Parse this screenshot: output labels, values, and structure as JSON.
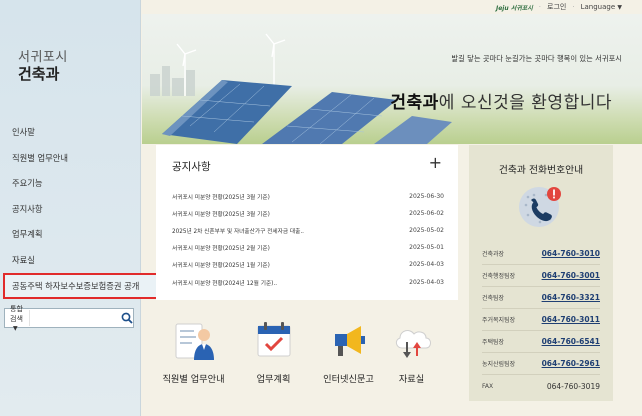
{
  "topbar": {
    "logo_text": "Jeju 서귀포시",
    "login": "로그인",
    "language": "Language"
  },
  "sidebar": {
    "site_name": "서귀포시",
    "title": "건축과",
    "menu": [
      {
        "label": "인사말"
      },
      {
        "label": "직원별 업무안내"
      },
      {
        "label": "주요기능"
      },
      {
        "label": "공지사항"
      },
      {
        "label": "업무계획"
      },
      {
        "label": "자료실"
      },
      {
        "label": "공동주택 하자보수보증보험증권 공개"
      }
    ],
    "search": {
      "select_label": "통합검색",
      "placeholder": ""
    }
  },
  "hero": {
    "slogan": "발길 닿는 곳마다 눈길가는 곳마다 행복이 있는 서귀포시",
    "welcome_bold": "건축과",
    "welcome_rest": "에 오신것을 환영합니다"
  },
  "notice": {
    "title": "공지사항",
    "more": "+",
    "items": [
      {
        "title": "서귀포시 미분양 현황(2025년 3월 기준)",
        "date": "2025-06-30"
      },
      {
        "title": "서귀포시 미분양 현황(2025년 3월 기준)",
        "date": "2025-06-02"
      },
      {
        "title": "2025년 2차 신혼부부 및 자녀출산가구 전세자금 대출..",
        "date": "2025-05-02"
      },
      {
        "title": "서귀포시 미분양 현황(2025년 2월 기준)",
        "date": "2025-05-01"
      },
      {
        "title": "서귀포시 미분양 현황(2025년 1월 기준)",
        "date": "2025-04-03"
      },
      {
        "title": "서귀포시 미분양 현황(2024년 12월 기준)..",
        "date": "2025-04-03"
      }
    ]
  },
  "phone": {
    "title": "건축과 전화번호안내",
    "items": [
      {
        "label": "건축과장",
        "number": "064-760-3010"
      },
      {
        "label": "건축행정팀장",
        "number": "064-760-3001"
      },
      {
        "label": "건축팀장",
        "number": "064-760-3321"
      },
      {
        "label": "주거복지팀장",
        "number": "064-760-3011"
      },
      {
        "label": "주택팀장",
        "number": "064-760-6541"
      },
      {
        "label": "농지산림팀장",
        "number": "064-760-2961"
      },
      {
        "label": "FAX",
        "number": "064-760-3019"
      }
    ]
  },
  "quick": [
    {
      "label": "직원별 업무안내",
      "icon": "staff-icon"
    },
    {
      "label": "업무계획",
      "icon": "calendar-icon"
    },
    {
      "label": "인터넷신문고",
      "icon": "megaphone-icon"
    },
    {
      "label": "자료실",
      "icon": "cloud-download-icon"
    }
  ],
  "colors": {
    "highlight": "#e12b2b",
    "phone_number": "#1f3f73",
    "sidebar_bg": "#d6e4ec"
  }
}
